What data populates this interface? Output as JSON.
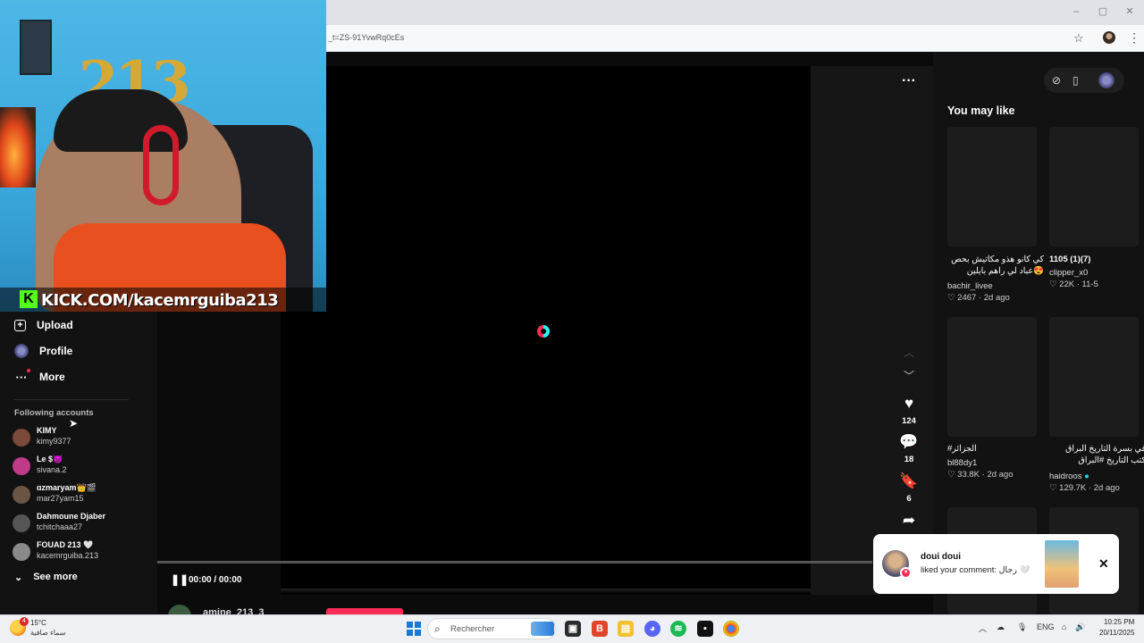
{
  "browser": {
    "url": "_t=ZS-91YvwRq0cEs",
    "star_icon": "star-icon",
    "menu_icon": "kebab-icon"
  },
  "webcam": {
    "balloon_text": "213",
    "banner_text": "KICK.COM/kacemrguiba213",
    "kick_logo": "K"
  },
  "sidebar": {
    "nav": [
      {
        "label": "Upload",
        "icon": "plus-square-icon"
      },
      {
        "label": "Profile",
        "icon": "avatar-icon"
      },
      {
        "label": "More",
        "icon": "ellipsis-icon"
      }
    ],
    "following_title": "Following accounts",
    "accounts": [
      {
        "name": "KIMY",
        "handle": "kimy9377",
        "color": "#7a4a3a"
      },
      {
        "name": "Le $😈",
        "handle": "sivana.2",
        "color": "#c03a8a"
      },
      {
        "name": "ɑzmaryam👑🎬",
        "handle": "mar27yam15",
        "color": "#6a5444"
      },
      {
        "name": "Dahmoune Djaber",
        "handle": "tchitchaaa27",
        "color": "#555555"
      },
      {
        "name": "FOUAD 213 🤍",
        "handle": "kacemrguiba.213",
        "color": "#8a8a8a"
      }
    ],
    "see_more": "See more"
  },
  "video": {
    "likes": "124",
    "comments": "18",
    "saves": "6",
    "time": "00:00 / 00:00",
    "next_author": "amine_213_3",
    "more_icon": "ellipsis-icon"
  },
  "recommendations": {
    "title": "You may like",
    "cards": [
      {
        "title": "كي كانو هذو مكاتيش بحص 😍عباد لي راهم بايلين دقـ...",
        "user": "bachir_livee",
        "likes": "2467",
        "age": "2d ago",
        "verified": false
      },
      {
        "title": "1105 (1)(7)",
        "user": "clipper_x0",
        "likes": "22K",
        "age": "11-5",
        "verified": false
      },
      {
        "title": "#الجزائر",
        "user": "bl88dy1",
        "likes": "33.8K",
        "age": "2d ago",
        "verified": false
      },
      {
        "title": "في بسرة التاريخ البراق كتب التاريخ #البراق",
        "user": "haidroos",
        "likes": "129.7K",
        "age": "2d ago",
        "verified": true
      }
    ]
  },
  "notification": {
    "name": "doui doui",
    "text": "liked your comment: رجال 🤍"
  },
  "taskbar": {
    "temperature": "15°C",
    "weather_desc": "سماء صافية",
    "weather_badge": "4",
    "search_placeholder": "Rechercher",
    "language": "ENG",
    "time": "10:25 PM",
    "date": "20/11/2025"
  }
}
